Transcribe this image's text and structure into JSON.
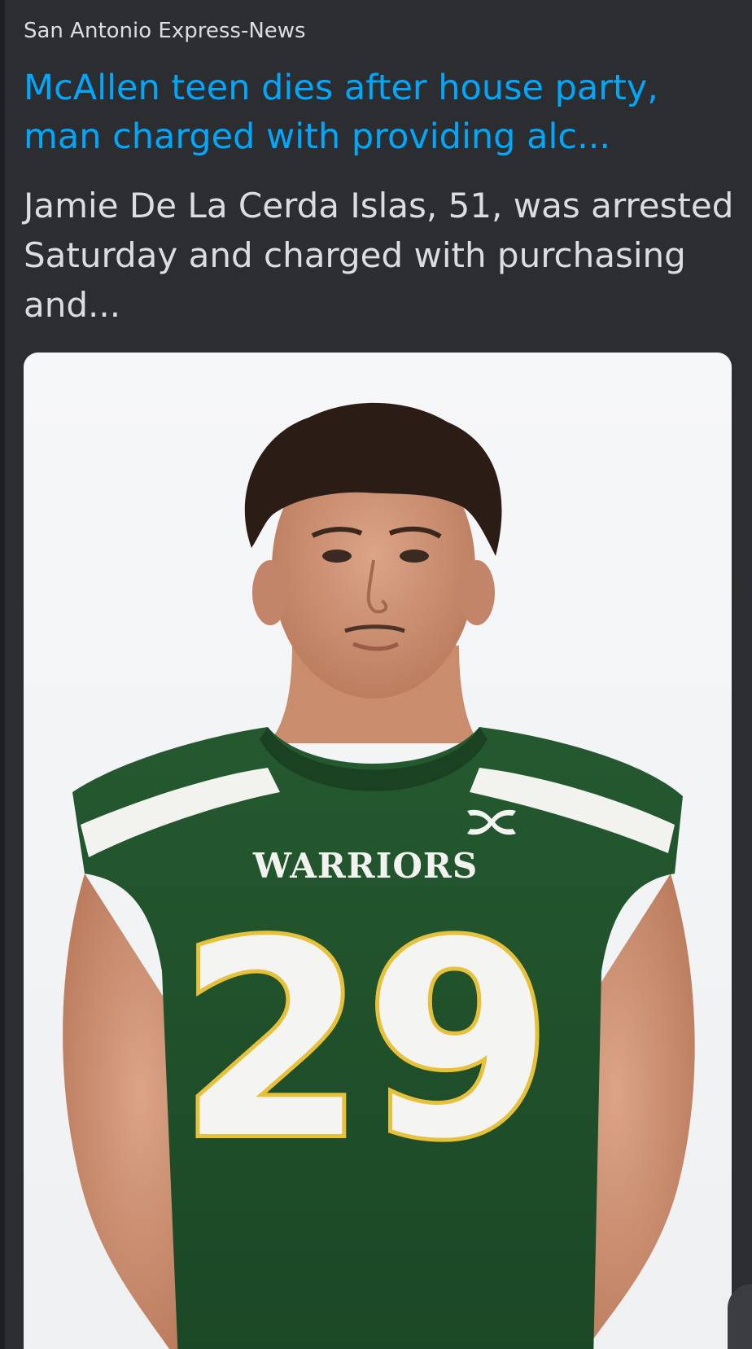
{
  "embed": {
    "provider": "San Antonio Express-News",
    "title": "McAllen teen dies after house party, man charged with providing alc...",
    "description": "Jamie De La Cerda Islas, 51, was arrested Saturday and charged with purchasing and..."
  },
  "thumbnail": {
    "jersey_text": "WARRIORS",
    "jersey_number": "29",
    "icon": "under-armour-logo"
  },
  "colors": {
    "background": "#2b2d31",
    "link": "#00a8fc",
    "text": "#dbdee1",
    "jersey_green": "#1f4d2a",
    "number_gold": "#e8c13a"
  }
}
